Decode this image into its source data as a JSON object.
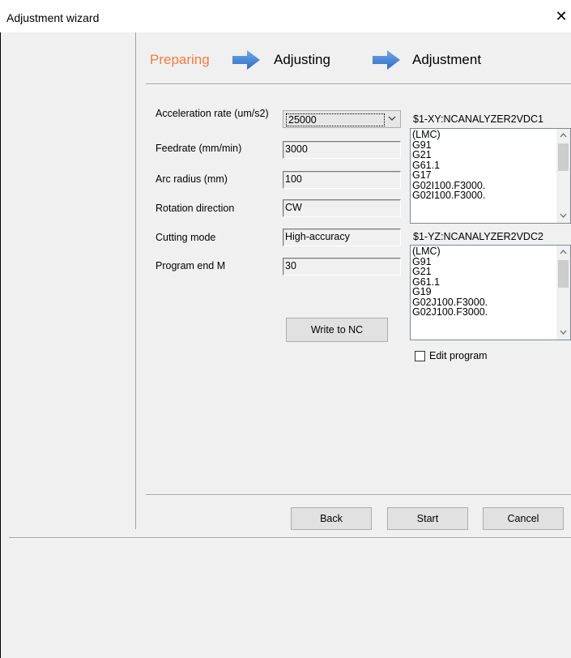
{
  "window": {
    "title": "Adjustment wizard",
    "close_glyph": "✕"
  },
  "steps": [
    {
      "label": "Preparing",
      "state": "active"
    },
    {
      "label": "Adjusting",
      "state": "pending"
    },
    {
      "label": "Adjustment",
      "state": "pending"
    }
  ],
  "form": {
    "acceleration": {
      "label": "Acceleration rate (um/s2)",
      "value": "25000"
    },
    "feedrate": {
      "label": "Feedrate (mm/min)",
      "value": "3000"
    },
    "arc_radius": {
      "label": "Arc radius (mm)",
      "value": "100"
    },
    "rotation": {
      "label": "Rotation direction",
      "value": "CW"
    },
    "cutting_mode": {
      "label": "Cutting mode",
      "value": "High-accuracy"
    },
    "program_end": {
      "label": "Program end M",
      "value": "30"
    }
  },
  "write_button": "Write to NC",
  "programs": [
    {
      "title": "$1-XY:NCANALYZER2VDC1",
      "lines": [
        "(LMC)",
        "G91",
        "G21",
        "G61.1",
        "G17",
        "G02I100.F3000.",
        "G02I100.F3000."
      ]
    },
    {
      "title": "$1-YZ:NCANALYZER2VDC2",
      "lines": [
        "(LMC)",
        "G91",
        "G21",
        "G61.1",
        "G19",
        "G02J100.F3000.",
        "G02J100.F3000."
      ]
    }
  ],
  "edit_program": {
    "label": "Edit program",
    "checked": false
  },
  "buttons": {
    "back": "Back",
    "start": "Start",
    "cancel": "Cancel"
  },
  "colors": {
    "active_step": "#f47b3f",
    "arrow": "#3b7dd8"
  },
  "icons": {
    "step_arrow": "right-arrow-icon",
    "combo": "chevron-down-icon",
    "scroll_up": "scroll-up-icon",
    "scroll_down": "scroll-down-icon"
  }
}
